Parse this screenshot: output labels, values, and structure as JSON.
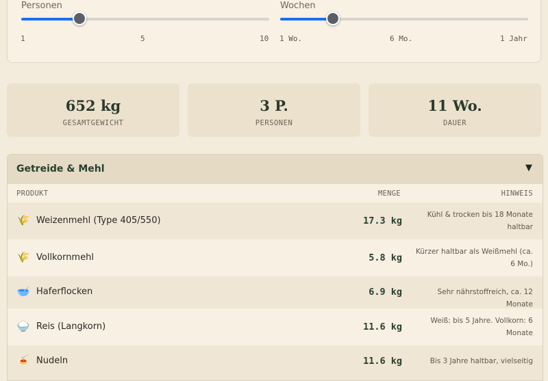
{
  "sliders": {
    "persons": {
      "label": "Personen",
      "value": 3,
      "min": 1,
      "max": 10,
      "fraction": 0.222,
      "ticks": [
        "1",
        "5",
        "10"
      ]
    },
    "weeks": {
      "label": "Wochen",
      "value": 11,
      "fraction": 0.2,
      "ticks": [
        "1 Wo.",
        "6 Mo.",
        "1 Jahr"
      ]
    }
  },
  "stats": [
    {
      "value": "652 kg",
      "label": "GESAMTGEWICHT"
    },
    {
      "value": "3 P.",
      "label": "PERSONEN"
    },
    {
      "value": "11 Wo.",
      "label": "DAUER"
    }
  ],
  "category": {
    "title": "Getreide & Mehl",
    "toggle": "▼"
  },
  "columns": {
    "product": "PRODUKT",
    "quantity": "MENGE",
    "note": "HINWEIS"
  },
  "rows": [
    {
      "icon": "wheat-icon",
      "glyph": "🌾",
      "name": "Weizenmehl (Type 405/550)",
      "qty": "17.3 kg",
      "note": "Kühl & trocken bis 18 Monate haltbar"
    },
    {
      "icon": "wheat-icon",
      "glyph": "🌾",
      "name": "Vollkornmehl",
      "qty": "5.8 kg",
      "note": "Kürzer haltbar als Weißmehl (ca. 6 Mo.)"
    },
    {
      "icon": "bowl-icon",
      "glyph": "🥣",
      "name": "Haferflocken",
      "qty": "6.9 kg",
      "note": "Sehr nährstoffreich, ca. 12 Monate"
    },
    {
      "icon": "rice-icon",
      "glyph": "🍚",
      "name": "Reis (Langkorn)",
      "qty": "11.6 kg",
      "note": "Weiß: bis 5 Jahre. Vollkorn: 6 Monate"
    },
    {
      "icon": "noodles-icon",
      "glyph": "🍝",
      "name": "Nudeln",
      "qty": "11.6 kg",
      "note": "Bis 3 Jahre haltbar, vielseitig"
    }
  ],
  "colors": {
    "accent": "#1b6ef3",
    "thumb": "#5c5f66",
    "background": "#f3ebdc",
    "heading": "#27402e"
  }
}
